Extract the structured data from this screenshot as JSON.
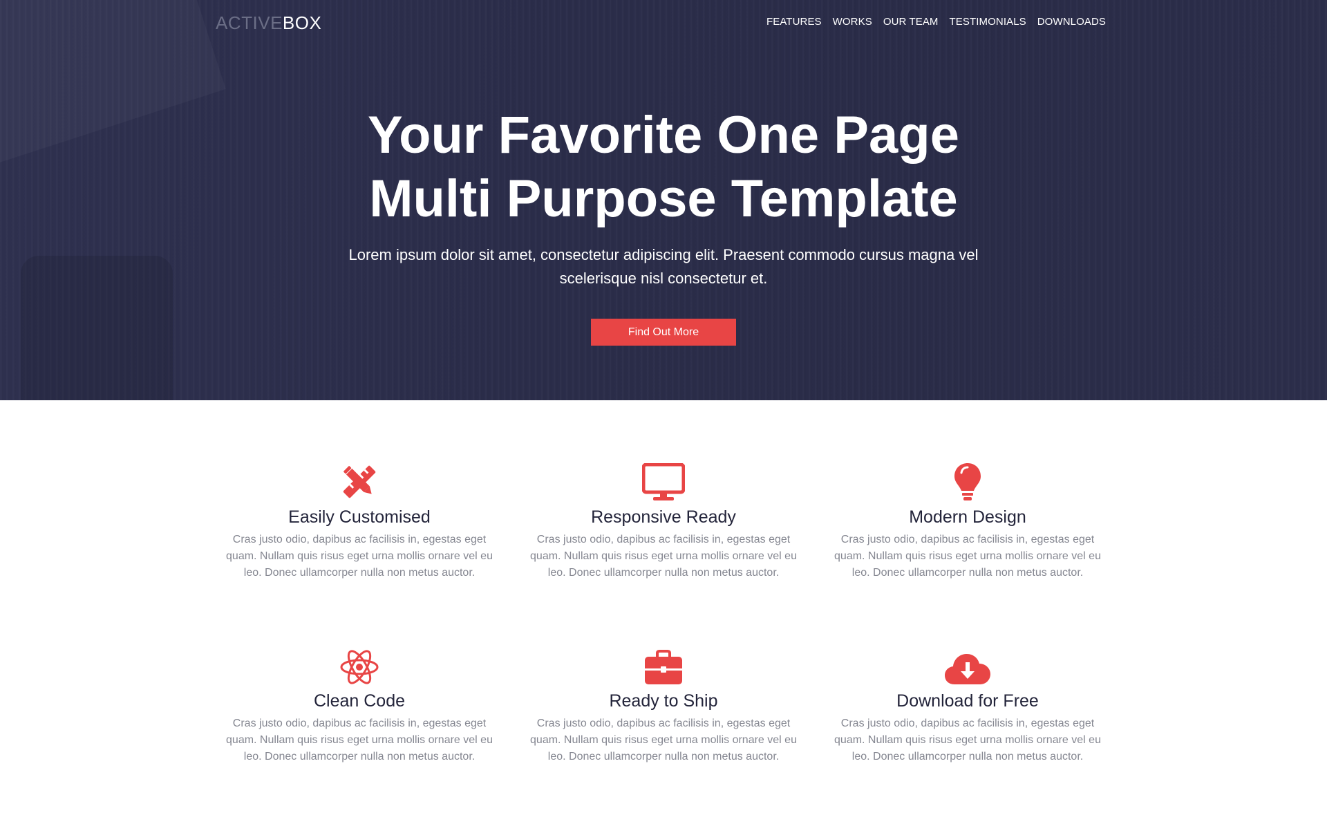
{
  "brand": {
    "part1": "ACTIVE",
    "part2": "BOX"
  },
  "nav": {
    "items": [
      "FEATURES",
      "WORKS",
      "OUR TEAM",
      "TESTIMONIALS",
      "DOWNLOADS"
    ]
  },
  "hero": {
    "title_line1": "Your Favorite One Page",
    "title_line2": "Multi Purpose Template",
    "subtitle": "Lorem ipsum dolor sit amet, consectetur adipiscing elit. Praesent commodo cursus magna vel scelerisque nisl consectetur et.",
    "cta_label": "Find Out More"
  },
  "colors": {
    "hero_bg": "#2b2d4a",
    "accent": "#e84545",
    "heading": "#23243a",
    "body_text": "#858791"
  },
  "features": [
    {
      "icon": "pencil-ruler-icon",
      "title": "Easily Customised",
      "text": "Cras justo odio, dapibus ac facilisis in, egestas eget quam. Nullam quis risus eget urna mollis ornare vel eu leo. Donec ullamcorper nulla non metus auctor."
    },
    {
      "icon": "monitor-icon",
      "title": "Responsive Ready",
      "text": "Cras justo odio, dapibus ac facilisis in, egestas eget quam. Nullam quis risus eget urna mollis ornare vel eu leo. Donec ullamcorper nulla non metus auctor."
    },
    {
      "icon": "lightbulb-icon",
      "title": "Modern Design",
      "text": "Cras justo odio, dapibus ac facilisis in, egestas eget quam. Nullam quis risus eget urna mollis ornare vel eu leo. Donec ullamcorper nulla non metus auctor."
    },
    {
      "icon": "atom-icon",
      "title": "Clean Code",
      "text": "Cras justo odio, dapibus ac facilisis in, egestas eget quam. Nullam quis risus eget urna mollis ornare vel eu leo. Donec ullamcorper nulla non metus auctor."
    },
    {
      "icon": "briefcase-icon",
      "title": "Ready to Ship",
      "text": "Cras justo odio, dapibus ac facilisis in, egestas eget quam. Nullam quis risus eget urna mollis ornare vel eu leo. Donec ullamcorper nulla non metus auctor."
    },
    {
      "icon": "cloud-download-icon",
      "title": "Download for Free",
      "text": "Cras justo odio, dapibus ac facilisis in, egestas eget quam. Nullam quis risus eget urna mollis ornare vel eu leo. Donec ullamcorper nulla non metus auctor."
    }
  ]
}
